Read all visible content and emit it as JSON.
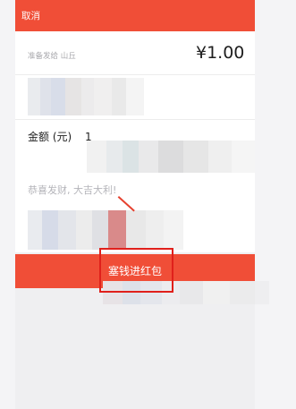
{
  "header": {
    "cancel_label": "取消"
  },
  "form": {
    "send_to_text": "准备发给 山丘",
    "amount_display": "¥1.00",
    "amount_label": "金额 (元)",
    "amount_value": "1",
    "greeting_placeholder": "恭喜发财, 大吉大利!"
  },
  "action": {
    "send_button_label": "塞钱进红包"
  },
  "colors": {
    "brand_red": "#f04e37",
    "highlight": "#e0201b"
  }
}
